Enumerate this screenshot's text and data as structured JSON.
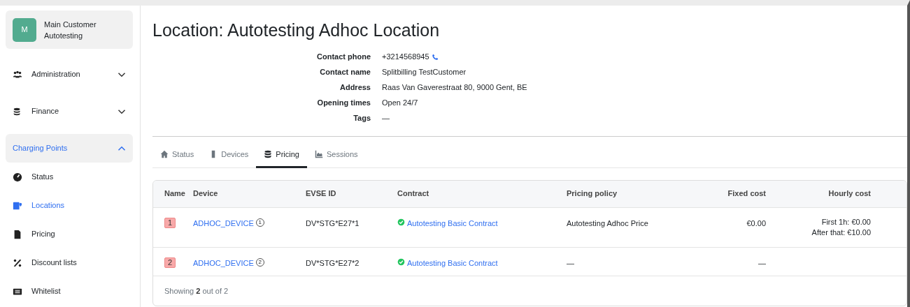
{
  "account": {
    "initial": "M",
    "name": "Main Customer Autotesting"
  },
  "nav": [
    {
      "label": "Administration",
      "kind": "group",
      "expanded": false,
      "selected": false
    },
    {
      "label": "Finance",
      "kind": "group",
      "expanded": false,
      "selected": false
    },
    {
      "label": "Charging Points",
      "kind": "group",
      "expanded": true,
      "selected": true
    },
    {
      "label": "Status",
      "kind": "link",
      "selected": false
    },
    {
      "label": "Locations",
      "kind": "link",
      "selected": true
    },
    {
      "label": "Pricing",
      "kind": "link",
      "selected": false
    },
    {
      "label": "Discount lists",
      "kind": "link",
      "selected": false
    },
    {
      "label": "Whitelist",
      "kind": "link",
      "selected": false
    }
  ],
  "title": "Location: Autotesting Adhoc Location",
  "details": [
    {
      "label": "Contact phone",
      "value": "+3214568945",
      "kind": "phone"
    },
    {
      "label": "Contact name",
      "value": "Splitbilling TestCustomer",
      "kind": "text"
    },
    {
      "label": "Address",
      "value": "Raas Van Gaverestraat 80, 9000 Gent, BE",
      "kind": "text"
    },
    {
      "label": "Opening times",
      "value": "Open 24/7",
      "kind": "text"
    },
    {
      "label": "Tags",
      "value": "—",
      "kind": "text"
    }
  ],
  "tabs": [
    {
      "label": "Status",
      "selected": false
    },
    {
      "label": "Devices",
      "selected": false
    },
    {
      "label": "Pricing",
      "selected": true
    },
    {
      "label": "Sessions",
      "selected": false
    }
  ],
  "table": {
    "columns": [
      "Name",
      "Device",
      "EVSE ID",
      "Contract",
      "Pricing policy",
      "Fixed cost",
      "Hourly cost"
    ],
    "rows": [
      {
        "name": "1",
        "device": "ADHOC_DEVICE",
        "device_number": "1",
        "evse_id": "DV*STG*E27*1",
        "contract": "Autotesting Basic Contract",
        "pricing_policy": "Autotesting Adhoc Price",
        "fixed_cost": "€0.00",
        "hourly_cost": [
          "First 1h: €0.00",
          "After that: €10.00"
        ]
      },
      {
        "name": "2",
        "device": "ADHOC_DEVICE",
        "device_number": "2",
        "evse_id": "DV*STG*E27*2",
        "contract": "Autotesting Basic Contract",
        "pricing_policy": "—",
        "fixed_cost": "—",
        "hourly_cost": []
      }
    ],
    "footer": "Showing **2** out of 2"
  }
}
